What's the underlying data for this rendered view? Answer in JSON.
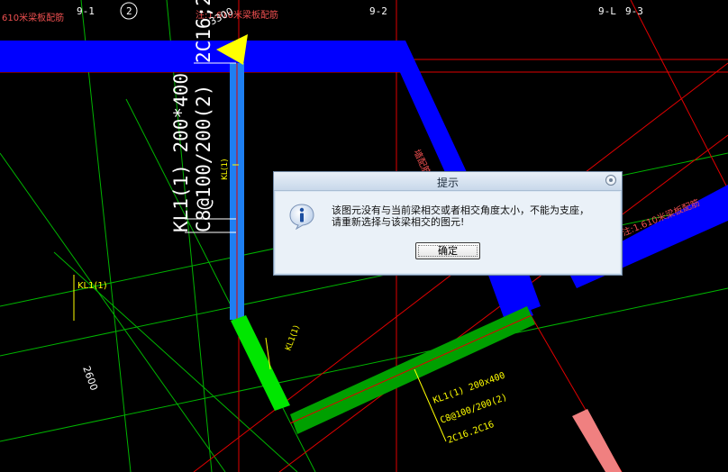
{
  "canvas": {
    "axis_labels": {
      "a1": "9-1",
      "a2": "2",
      "a3": "9-2",
      "a4": "9-L",
      "a5": "9-3"
    },
    "top_left_text": "610米梁板配筋",
    "top_mid_text": "注:1.610米梁板配筋",
    "right_note_text": "注:1.610米梁板配筋",
    "diag_vertical_text": "墙配筋",
    "dim_small_top": "3300",
    "dim_2600": "2600",
    "vertical_beam": {
      "line1": "KL1(1) 200*400",
      "line2": "C8@100/200(2)",
      "line3": "2C16;2"
    },
    "small_marker_text": "KL(1)",
    "left_small_label": "KL1(1)",
    "green_short_label": "KL1(1)",
    "green_beam": {
      "line1": "KL1(1) 200x400",
      "line2": "C8@100/200(2)",
      "line3": "2C16.2C16"
    }
  },
  "dialog": {
    "title": "提示",
    "message_line1": "该图元没有与当前梁相交或者相交角度太小，不能为支座，",
    "message_line2": "请重新选择与该梁相交的图元!",
    "ok_label": "确定"
  },
  "colors": {
    "background": "#000000",
    "beam_blue": "#0000ff",
    "beam_selected": "#1e7ff2",
    "beam_green": "#00e600",
    "dark_green": "#00a000",
    "axis_red": "#e00000",
    "text_yellow": "#ffff00",
    "pink_beam": "#f08080"
  }
}
